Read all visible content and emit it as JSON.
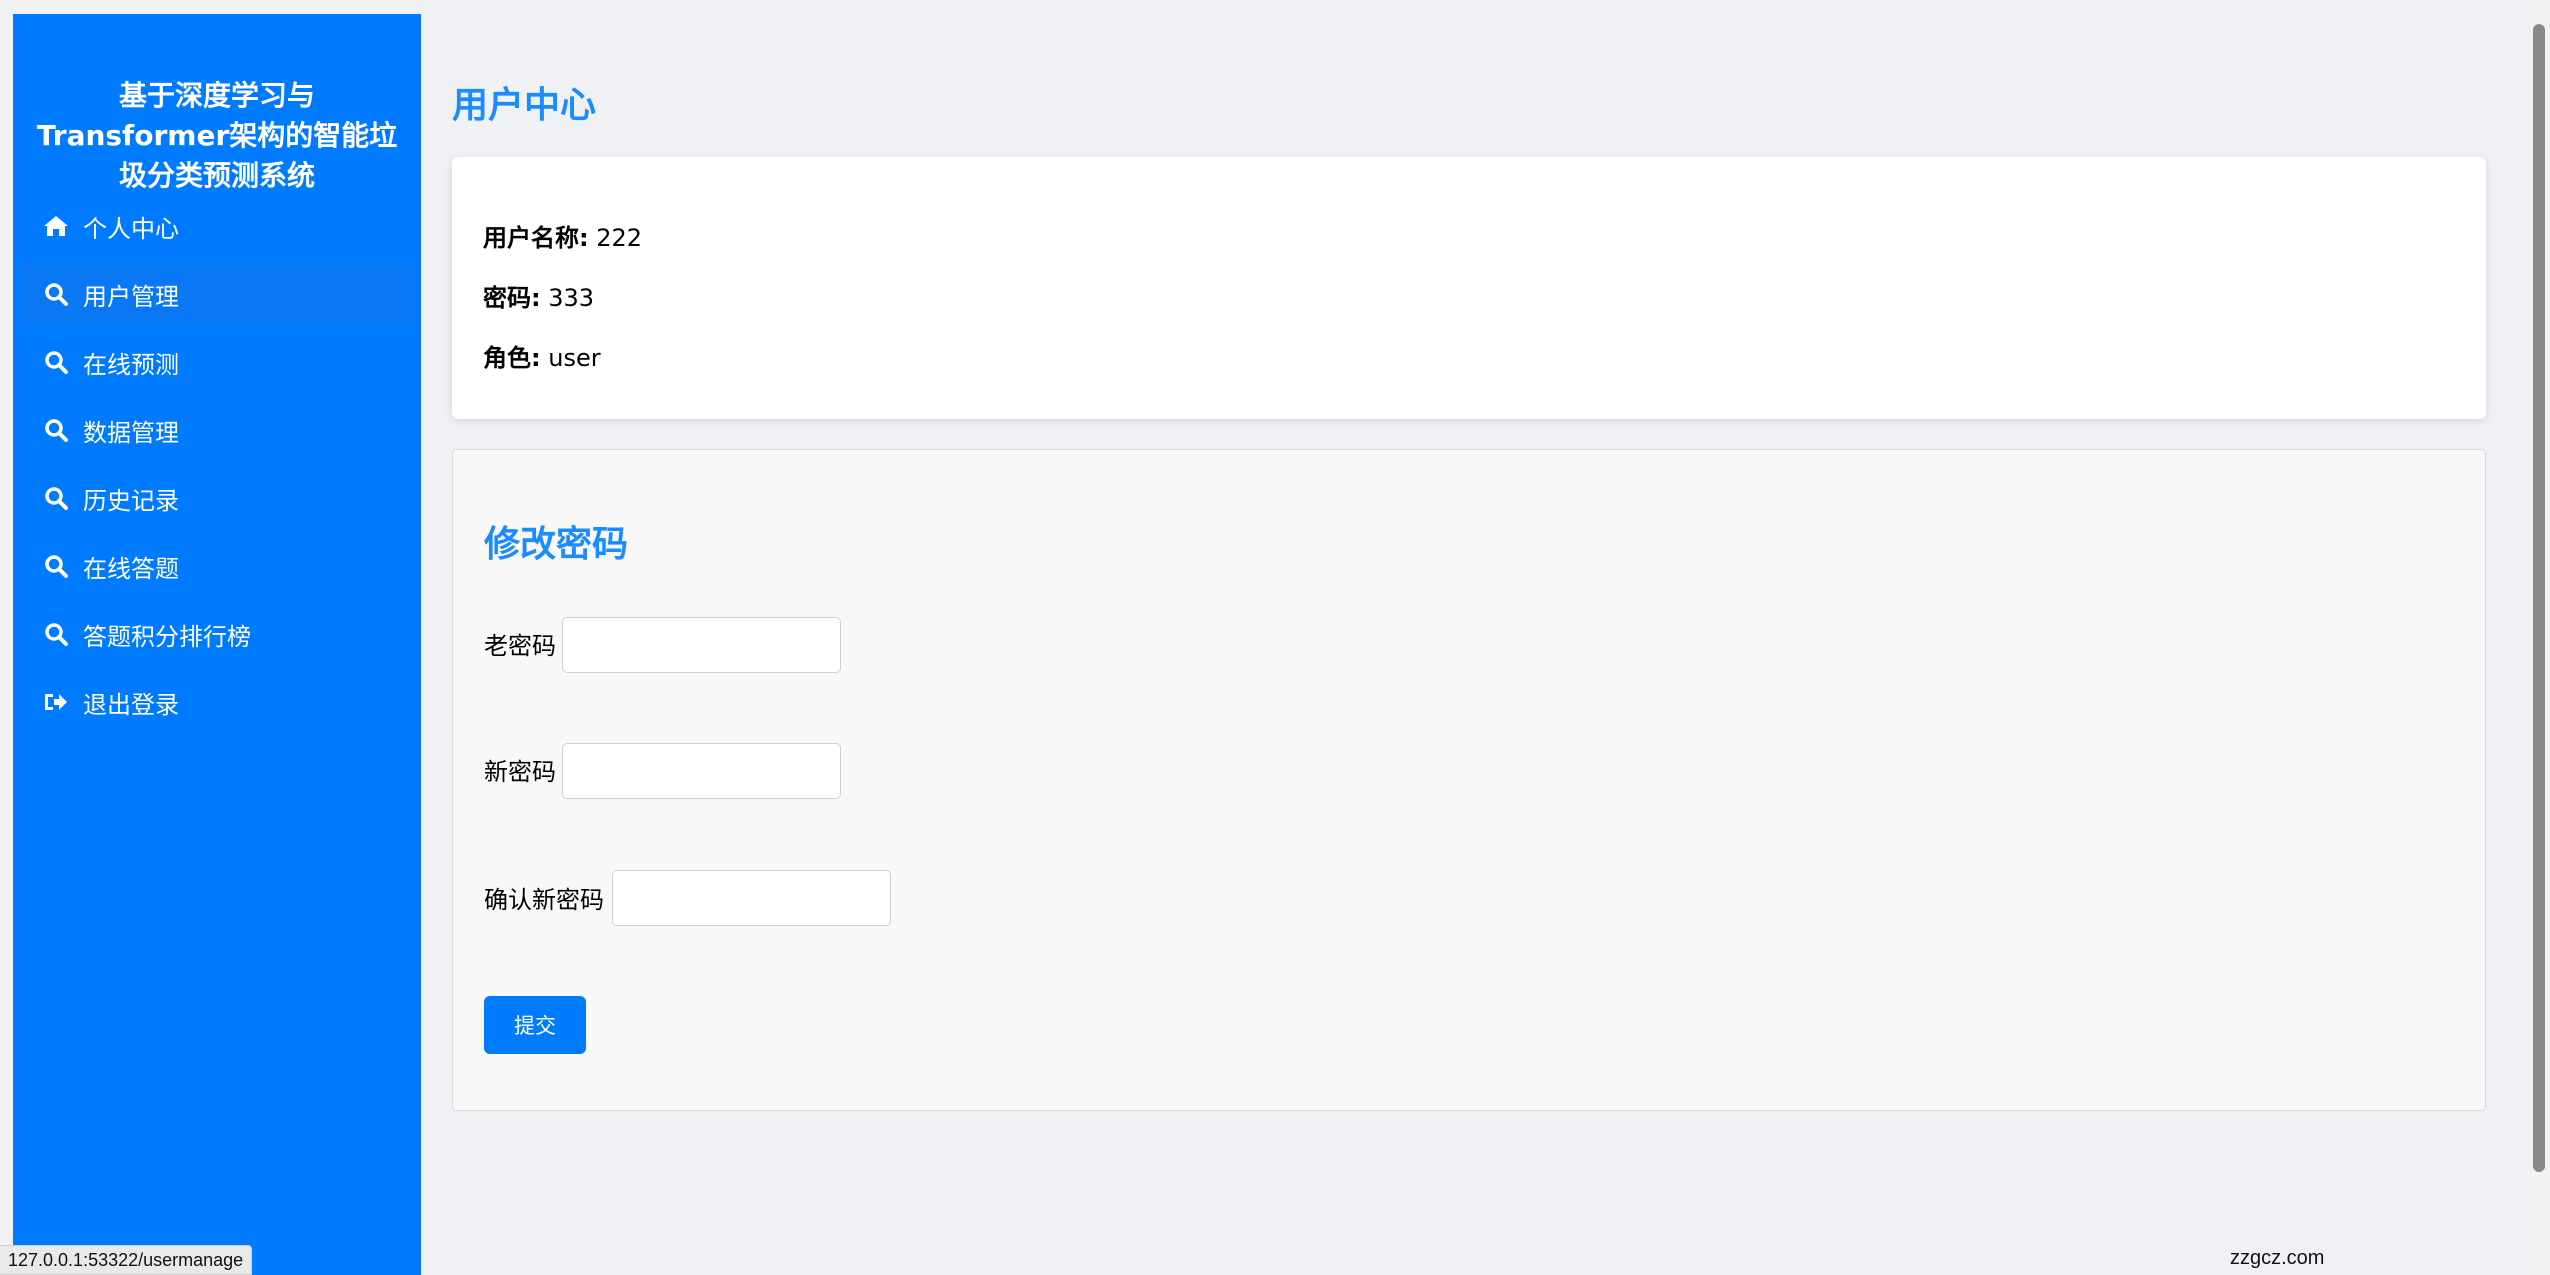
{
  "sidebar": {
    "title": "基于深度学习与Transformer架构的智能垃圾分类预测系统",
    "items": [
      {
        "label": "个人中心",
        "icon": "home-icon"
      },
      {
        "label": "用户管理",
        "icon": "search-icon"
      },
      {
        "label": "在线预测",
        "icon": "search-icon"
      },
      {
        "label": "数据管理",
        "icon": "search-icon"
      },
      {
        "label": "历史记录",
        "icon": "search-icon"
      },
      {
        "label": "在线答题",
        "icon": "search-icon"
      },
      {
        "label": "答题积分排行榜",
        "icon": "search-icon"
      },
      {
        "label": "退出登录",
        "icon": "sign-out-icon"
      }
    ]
  },
  "main": {
    "title": "用户中心",
    "info": {
      "username_label": "用户名称:",
      "username_value": "222",
      "password_label": "密码:",
      "password_value": "333",
      "role_label": "角色:",
      "role_value": "user"
    },
    "change_password": {
      "title": "修改密码",
      "old_label": "老密码",
      "old_value": "",
      "new_label": "新密码",
      "new_value": "",
      "confirm_label": "确认新密码",
      "confirm_value": "",
      "submit_label": "提交"
    }
  },
  "status_bar": {
    "url": "127.0.0.1:53322/usermanage"
  },
  "watermark": "zzgcz.com",
  "colors": {
    "accent": "#007bff",
    "heading": "#1a8cff",
    "background": "#f0f1f5"
  }
}
